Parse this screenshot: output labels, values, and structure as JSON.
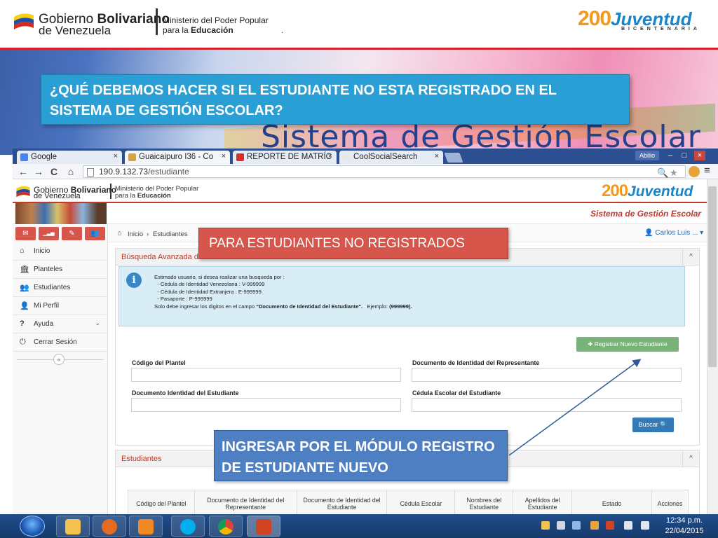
{
  "slide": {
    "gov_line1_a": "Gobierno ",
    "gov_line1_b": "Bolivariano",
    "gov_line2": "de Venezuela",
    "ministry_line1": "Ministerio  del Poder Popular",
    "ministry_line2_a": "para la ",
    "ministry_line2_b": "Educación",
    "dot": ".",
    "juventud_num": "200",
    "juventud_word": "Juventud",
    "juventud_sub": "BICENTENARIA",
    "watermark": "Sistema de Gestión Escolar",
    "question": "¿QUÉ DEBEMOS HACER SI EL ESTUDIANTE NO ESTA REGISTRADO EN EL SISTEMA DE GESTIÓN ESCOLAR?",
    "callout_no_registrados": "PARA ESTUDIANTES NO REGISTRADOS",
    "callout_modulo": "INGRESAR POR EL MÓDULO REGISTRO DE ESTUDIANTE NUEVO"
  },
  "browser": {
    "tabs": [
      {
        "label": "Google",
        "color": "#4285f4"
      },
      {
        "label": "Guaicaipuro I36 - Co",
        "color": "#d9a23a"
      },
      {
        "label": "REPORTE DE MATRÍC",
        "color": "#d93025"
      },
      {
        "label": "CoolSocialSearch",
        "color": "#e8e8e8"
      }
    ],
    "close_glyph": "×",
    "user_badge": "Abilio",
    "win_min": "–",
    "win_max": "□",
    "win_close": "×",
    "nav_back": "←",
    "nav_forward": "→",
    "nav_reload": "C",
    "nav_home": "⌂",
    "url_host": "190.9.132.73",
    "url_path": "/estudiante",
    "addr_zoom": "🔍",
    "addr_star": "★",
    "addr_menu": "≡"
  },
  "app": {
    "gov1_a": "Gobierno ",
    "gov1_b": "Bolivariano",
    "gov2": "de Venezuela",
    "min1": "Ministerio del Poder Popular",
    "min2_a": "para la ",
    "min2_b": "Educación",
    "system_title": "Sistema de Gestión Escolar",
    "shortcut_colors": [
      "#d6564c",
      "#d6564c",
      "#d6564c",
      "#d6564c"
    ],
    "shortcut_icons": [
      "✉",
      "▁▃▅",
      "✎",
      "👥"
    ],
    "sidebar": [
      {
        "label": "Inicio",
        "icon": "⌂"
      },
      {
        "label": "Planteles",
        "icon": "🏛"
      },
      {
        "label": "Estudiantes",
        "icon": "👥"
      },
      {
        "label": "Mi Perfil",
        "icon": "👤"
      },
      {
        "label": "Ayuda",
        "icon": "?",
        "chevron": "⌄"
      },
      {
        "label": "Cerrar Sesión",
        "icon": "⏻"
      }
    ],
    "collapse_glyph": "«",
    "breadcrumb": {
      "home_icon": "⌂",
      "inicio": "Inicio",
      "sep": "›",
      "current": "Estudiantes",
      "user": "👤 Carlos Luis ... ▾"
    },
    "search_panel": {
      "title": "Búsqueda Avanzada de Estudiantes",
      "toggle": "^",
      "info_icon": "i",
      "info_lines": [
        "Estimado usuario, si desea realizar una busqueda por :",
        "  - Cédula de Identidad Venezolana : V-999999",
        "  - Cédula de Identidad Extranjera : E-999999",
        "  - Pasaporte : P-999999"
      ],
      "info_last_a": "Solo debe ingresar los digitos en el campo ",
      "info_last_b": "\"Documento de Identidad del Estudiante\".",
      "info_last_c": "   Ejemplo: ",
      "info_last_d": "(999999).",
      "register_button": "✚ Registrar Nuevo Estudiante",
      "label_codigo_plantel": "Código del Plantel",
      "label_doc_representante": "Documento de Identidad del Representante",
      "label_doc_estudiante": "Documento Identidad del Estudiante",
      "label_cedula_escolar": "Cédula Escolar del Estudiante",
      "search_button": "Buscar 🔍"
    },
    "students_panel": {
      "title": "Estudiantes",
      "toggle": "^",
      "columns": [
        "Código del Plantel",
        "Documento de Identidad del Representante",
        "Documento de Identidad del Estudiante",
        "Cédula Escolar",
        "Nombres del Estudiante",
        "Apellidos del Estudiante",
        "Estado",
        "Acciones"
      ]
    }
  },
  "taskbar": {
    "apps": [
      {
        "name": "explorer",
        "color": "#f2c14e"
      },
      {
        "name": "firefox",
        "color": "#e66b1f"
      },
      {
        "name": "media-player",
        "color": "#f08a24"
      },
      {
        "name": "skype",
        "color": "#00aff0"
      },
      {
        "name": "chrome",
        "color": "#3aa757"
      },
      {
        "name": "powerpoint",
        "color": "#d04423"
      }
    ],
    "time": "12:34 p.m.",
    "date": "22/04/2015"
  }
}
